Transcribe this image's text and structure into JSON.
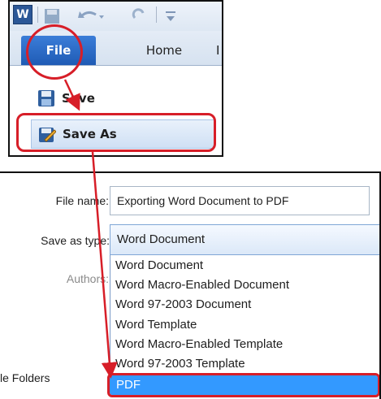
{
  "ribbon": {
    "app_icon_letter": "W",
    "tabs": {
      "file": "File",
      "home": "Home",
      "cut_tab": "I"
    }
  },
  "file_menu": {
    "items": [
      {
        "label": "Save",
        "icon": "floppy-disk-icon"
      },
      {
        "label": "Save As",
        "icon": "save-as-icon"
      }
    ]
  },
  "dialog": {
    "file_name_label": "File name:",
    "file_name_value": "Exporting Word Document to PDF",
    "save_type_label": "Save as type:",
    "save_type_value": "Word Document",
    "authors_label": "Authors:",
    "folders_label": "le Folders",
    "type_options": [
      "Word Document",
      "Word Macro-Enabled Document",
      "Word 97-2003 Document",
      "Word Template",
      "Word Macro-Enabled Template",
      "Word 97-2003 Template"
    ],
    "selected_option": "PDF"
  },
  "colors": {
    "highlight": "#d71e28",
    "file_tab": "#2b6ccc",
    "selection": "#3399ff"
  }
}
